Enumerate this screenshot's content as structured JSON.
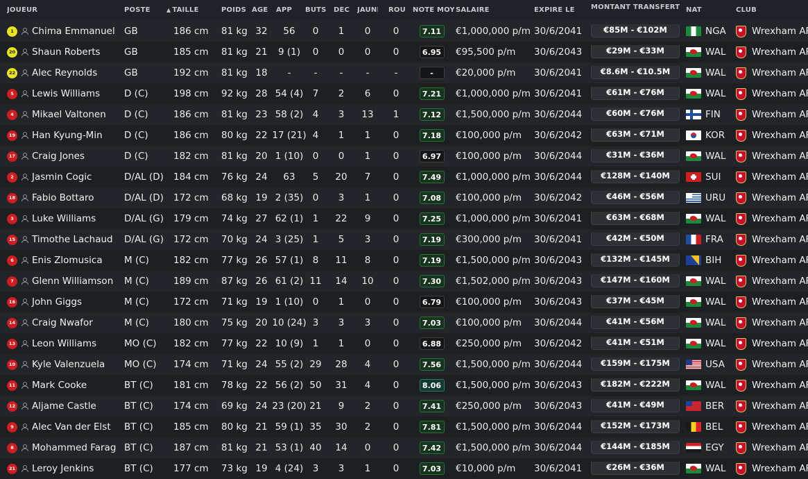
{
  "columns": {
    "player": "JOUEUR",
    "position": "POSTE",
    "height": "TAILLE",
    "weight": "POIDS",
    "age": "ÂGE",
    "apps": "APP",
    "goals": "BUTS",
    "assists": "DÉC",
    "yellow": "JAUNE",
    "red": "ROU",
    "rating": "NOTE MOY",
    "wage": "SALAIRE",
    "expires": "EXPIRE LE",
    "transfer_value": "MONTANT TRANSFERT",
    "nat": "NAT",
    "club": "CLUB"
  },
  "sort_icon": "sort-ascending-icon",
  "colors": {
    "background": "#1f2226",
    "gk_shirt": "#e8e51a",
    "outfield_shirt": "#d01d21",
    "rating_good": "#17341e",
    "rating_great": "#12382f"
  },
  "players": [
    {
      "shirt": "1",
      "shirt_type": "gk",
      "name": "Chima Emmanuel",
      "position": "GB",
      "height": "186 cm",
      "weight": "81 kg",
      "age": "32",
      "apps": "56",
      "goals": "0",
      "assists": "1",
      "yellow": "0",
      "red": "0",
      "rating": "7.11",
      "rating_tier": "good",
      "wage": "€1,000,000 p/m",
      "expires": "30/6/2041",
      "value": "€85M - €102M",
      "nat_flag": "nga",
      "nat": "NGA",
      "club": "Wrexham AF"
    },
    {
      "shirt": "20",
      "shirt_type": "gk",
      "name": "Shaun Roberts",
      "position": "GB",
      "height": "185 cm",
      "weight": "81 kg",
      "age": "21",
      "apps": "9 (1)",
      "goals": "0",
      "assists": "0",
      "yellow": "0",
      "red": "0",
      "rating": "6.95",
      "rating_tier": "avg",
      "wage": "€95,500 p/m",
      "expires": "30/6/2043",
      "value": "€29M - €33M",
      "nat_flag": "wal",
      "nat": "WAL",
      "club": "Wrexham AF"
    },
    {
      "shirt": "22",
      "shirt_type": "gk",
      "name": "Alec Reynolds",
      "position": "GB",
      "height": "192 cm",
      "weight": "81 kg",
      "age": "18",
      "apps": "-",
      "goals": "-",
      "assists": "-",
      "yellow": "-",
      "red": "-",
      "rating": "-",
      "rating_tier": "avg",
      "wage": "€20,000 p/m",
      "expires": "30/6/2041",
      "value": "€8.6M - €10.5M",
      "nat_flag": "wal",
      "nat": "WAL",
      "club": "Wrexham AF"
    },
    {
      "shirt": "5",
      "shirt_type": "out",
      "name": "Lewis Williams",
      "position": "D (C)",
      "height": "198 cm",
      "weight": "92 kg",
      "age": "28",
      "apps": "54 (4)",
      "goals": "7",
      "assists": "2",
      "yellow": "6",
      "red": "0",
      "rating": "7.21",
      "rating_tier": "good",
      "wage": "€1,000,000 p/m",
      "expires": "30/6/2041",
      "value": "€61M - €76M",
      "nat_flag": "wal",
      "nat": "WAL",
      "club": "Wrexham AF"
    },
    {
      "shirt": "4",
      "shirt_type": "out",
      "name": "Mikael Valtonen",
      "position": "D (C)",
      "height": "186 cm",
      "weight": "81 kg",
      "age": "23",
      "apps": "58 (2)",
      "goals": "4",
      "assists": "3",
      "yellow": "13",
      "red": "1",
      "rating": "7.12",
      "rating_tier": "good",
      "wage": "€1,500,000 p/m",
      "expires": "30/6/2044",
      "value": "€60M - €76M",
      "nat_flag": "fin",
      "nat": "FIN",
      "club": "Wrexham AF"
    },
    {
      "shirt": "19",
      "shirt_type": "out",
      "name": "Han Kyung-Min",
      "position": "D (C)",
      "height": "186 cm",
      "weight": "80 kg",
      "age": "22",
      "apps": "17 (21)",
      "goals": "4",
      "assists": "1",
      "yellow": "1",
      "red": "0",
      "rating": "7.18",
      "rating_tier": "good",
      "wage": "€100,000 p/m",
      "expires": "30/6/2042",
      "value": "€63M - €71M",
      "nat_flag": "kor",
      "nat": "KOR",
      "club": "Wrexham AF"
    },
    {
      "shirt": "17",
      "shirt_type": "out",
      "name": "Craig Jones",
      "position": "D (C)",
      "height": "182 cm",
      "weight": "81 kg",
      "age": "20",
      "apps": "1 (10)",
      "goals": "0",
      "assists": "0",
      "yellow": "1",
      "red": "0",
      "rating": "6.97",
      "rating_tier": "avg",
      "wage": "€100,000 p/m",
      "expires": "30/6/2044",
      "value": "€31M - €36M",
      "nat_flag": "wal",
      "nat": "WAL",
      "club": "Wrexham AF"
    },
    {
      "shirt": "2",
      "shirt_type": "out",
      "name": "Jasmin Cogic",
      "position": "D/AL (D)",
      "height": "184 cm",
      "weight": "76 kg",
      "age": "24",
      "apps": "63",
      "goals": "5",
      "assists": "20",
      "yellow": "7",
      "red": "0",
      "rating": "7.49",
      "rating_tier": "good",
      "wage": "€1,000,000 p/m",
      "expires": "30/6/2044",
      "value": "€128M - €140M",
      "nat_flag": "sui",
      "nat": "SUI",
      "club": "Wrexham AF"
    },
    {
      "shirt": "18",
      "shirt_type": "out",
      "name": "Fabio Bottaro",
      "position": "D/AL (D)",
      "height": "172 cm",
      "weight": "68 kg",
      "age": "19",
      "apps": "2 (35)",
      "goals": "0",
      "assists": "3",
      "yellow": "1",
      "red": "0",
      "rating": "7.08",
      "rating_tier": "good",
      "wage": "€100,000 p/m",
      "expires": "30/6/2042",
      "value": "€46M - €56M",
      "nat_flag": "uru",
      "nat": "URU",
      "club": "Wrexham AF"
    },
    {
      "shirt": "3",
      "shirt_type": "out",
      "name": "Luke Williams",
      "position": "D/AL (G)",
      "height": "179 cm",
      "weight": "74 kg",
      "age": "27",
      "apps": "62 (1)",
      "goals": "1",
      "assists": "22",
      "yellow": "9",
      "red": "0",
      "rating": "7.25",
      "rating_tier": "good",
      "wage": "€1,000,000 p/m",
      "expires": "30/6/2041",
      "value": "€63M - €68M",
      "nat_flag": "wal",
      "nat": "WAL",
      "club": "Wrexham AF"
    },
    {
      "shirt": "15",
      "shirt_type": "out",
      "name": "Timothe Lachaud",
      "position": "D/AL (G)",
      "height": "172 cm",
      "weight": "70 kg",
      "age": "24",
      "apps": "3 (25)",
      "goals": "1",
      "assists": "5",
      "yellow": "3",
      "red": "0",
      "rating": "7.19",
      "rating_tier": "good",
      "wage": "€300,000 p/m",
      "expires": "30/6/2041",
      "value": "€42M - €50M",
      "nat_flag": "fra",
      "nat": "FRA",
      "club": "Wrexham AF"
    },
    {
      "shirt": "6",
      "shirt_type": "out",
      "name": "Enis Zlomusica",
      "position": "M (C)",
      "height": "182 cm",
      "weight": "77 kg",
      "age": "26",
      "apps": "57 (1)",
      "goals": "8",
      "assists": "11",
      "yellow": "8",
      "red": "0",
      "rating": "7.19",
      "rating_tier": "good",
      "wage": "€1,500,000 p/m",
      "expires": "30/6/2043",
      "value": "€132M - €145M",
      "nat_flag": "bih",
      "nat": "BIH",
      "club": "Wrexham AF"
    },
    {
      "shirt": "7",
      "shirt_type": "out",
      "name": "Glenn Williamson",
      "position": "M (C)",
      "height": "189 cm",
      "weight": "87 kg",
      "age": "26",
      "apps": "61 (2)",
      "goals": "11",
      "assists": "14",
      "yellow": "10",
      "red": "0",
      "rating": "7.30",
      "rating_tier": "good",
      "wage": "€1,502,000 p/m",
      "expires": "30/6/2043",
      "value": "€147M - €160M",
      "nat_flag": "wal",
      "nat": "WAL",
      "club": "Wrexham AF"
    },
    {
      "shirt": "16",
      "shirt_type": "out",
      "name": "John Giggs",
      "position": "M (C)",
      "height": "172 cm",
      "weight": "71 kg",
      "age": "19",
      "apps": "1 (10)",
      "goals": "0",
      "assists": "1",
      "yellow": "0",
      "red": "0",
      "rating": "6.79",
      "rating_tier": "avg",
      "wage": "€100,000 p/m",
      "expires": "30/6/2043",
      "value": "€37M - €45M",
      "nat_flag": "wal",
      "nat": "WAL",
      "club": "Wrexham AF"
    },
    {
      "shirt": "14",
      "shirt_type": "out",
      "name": "Craig Nwafor",
      "position": "M (C)",
      "height": "180 cm",
      "weight": "75 kg",
      "age": "20",
      "apps": "10 (24)",
      "goals": "3",
      "assists": "3",
      "yellow": "3",
      "red": "0",
      "rating": "7.03",
      "rating_tier": "good",
      "wage": "€100,000 p/m",
      "expires": "30/6/2044",
      "value": "€41M - €56M",
      "nat_flag": "wal",
      "nat": "WAL",
      "club": "Wrexham AF"
    },
    {
      "shirt": "13",
      "shirt_type": "out",
      "name": "Leon Williams",
      "position": "MO (C)",
      "height": "182 cm",
      "weight": "77 kg",
      "age": "22",
      "apps": "10 (9)",
      "goals": "1",
      "assists": "1",
      "yellow": "0",
      "red": "0",
      "rating": "6.88",
      "rating_tier": "avg",
      "wage": "€250,000 p/m",
      "expires": "30/6/2042",
      "value": "€41M - €51M",
      "nat_flag": "wal",
      "nat": "WAL",
      "club": "Wrexham AF"
    },
    {
      "shirt": "10",
      "shirt_type": "out",
      "name": "Kyle Valenzuela",
      "position": "MO (C)",
      "height": "174 cm",
      "weight": "71 kg",
      "age": "24",
      "apps": "55 (2)",
      "goals": "29",
      "assists": "28",
      "yellow": "4",
      "red": "0",
      "rating": "7.56",
      "rating_tier": "good",
      "wage": "€1,500,000 p/m",
      "expires": "30/6/2044",
      "value": "€159M - €175M",
      "nat_flag": "usa",
      "nat": "USA",
      "club": "Wrexham AF"
    },
    {
      "shirt": "11",
      "shirt_type": "out",
      "name": "Mark Cooke",
      "position": "BT (C)",
      "height": "181 cm",
      "weight": "78 kg",
      "age": "22",
      "apps": "56 (2)",
      "goals": "50",
      "assists": "31",
      "yellow": "4",
      "red": "0",
      "rating": "8.06",
      "rating_tier": "great",
      "wage": "€1,500,000 p/m",
      "expires": "30/6/2043",
      "value": "€182M - €222M",
      "nat_flag": "wal",
      "nat": "WAL",
      "club": "Wrexham AF"
    },
    {
      "shirt": "12",
      "shirt_type": "out",
      "name": "Aljame Castle",
      "position": "BT (C)",
      "height": "174 cm",
      "weight": "69 kg",
      "age": "24",
      "apps": "23 (20)",
      "goals": "21",
      "assists": "9",
      "yellow": "2",
      "red": "0",
      "rating": "7.41",
      "rating_tier": "good",
      "wage": "€250,000 p/m",
      "expires": "30/6/2043",
      "value": "€41M - €49M",
      "nat_flag": "ber",
      "nat": "BER",
      "club": "Wrexham AF"
    },
    {
      "shirt": "9",
      "shirt_type": "out",
      "name": "Alec Van der Elst",
      "position": "BT (C)",
      "height": "185 cm",
      "weight": "80 kg",
      "age": "21",
      "apps": "59 (1)",
      "goals": "35",
      "assists": "30",
      "yellow": "2",
      "red": "0",
      "rating": "7.81",
      "rating_tier": "good",
      "wage": "€1,500,000 p/m",
      "expires": "30/6/2044",
      "value": "€152M - €173M",
      "nat_flag": "bel",
      "nat": "BEL",
      "club": "Wrexham AF"
    },
    {
      "shirt": "8",
      "shirt_type": "out",
      "name": "Mohammed Farag",
      "position": "BT (C)",
      "height": "187 cm",
      "weight": "81 kg",
      "age": "21",
      "apps": "53 (1)",
      "goals": "40",
      "assists": "14",
      "yellow": "0",
      "red": "0",
      "rating": "7.42",
      "rating_tier": "good",
      "wage": "€1,500,000 p/m",
      "expires": "30/6/2044",
      "value": "€144M - €185M",
      "nat_flag": "egy",
      "nat": "EGY",
      "club": "Wrexham AF"
    },
    {
      "shirt": "21",
      "shirt_type": "out",
      "name": "Leroy Jenkins",
      "position": "BT (C)",
      "height": "177 cm",
      "weight": "73 kg",
      "age": "19",
      "apps": "4 (24)",
      "goals": "3",
      "assists": "3",
      "yellow": "1",
      "red": "0",
      "rating": "7.03",
      "rating_tier": "good",
      "wage": "€10,000 p/m",
      "expires": "30/6/2041",
      "value": "€26M - €36M",
      "nat_flag": "wal",
      "nat": "WAL",
      "club": "Wrexham AF"
    }
  ]
}
